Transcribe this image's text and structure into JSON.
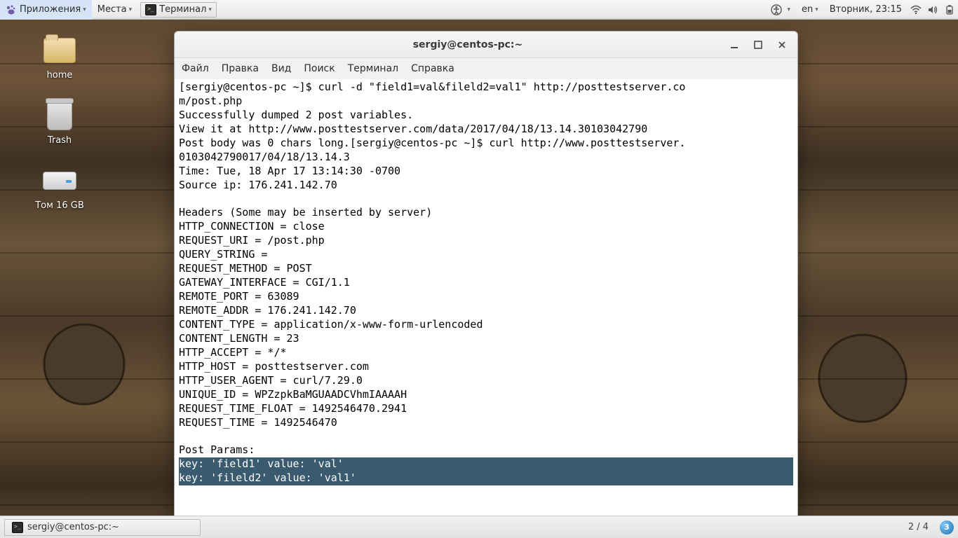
{
  "panel": {
    "applications": "Приложения",
    "places": "Места",
    "terminal": "Терминал",
    "lang": "en",
    "datetime": "Вторник, 23:15"
  },
  "desktop_icons": {
    "home": "home",
    "trash": "Trash",
    "volume": "Том 16 GB"
  },
  "window": {
    "title": "sergiy@centos-pc:~",
    "menu": {
      "file": "Файл",
      "edit": "Правка",
      "view": "Вид",
      "search": "Поиск",
      "terminal": "Терминал",
      "help": "Справка"
    },
    "lines": [
      "[sergiy@centos-pc ~]$ curl -d \"field1=val&fileld2=val1\" http://posttestserver.co",
      "m/post.php",
      "Successfully dumped 2 post variables.",
      "View it at http://www.posttestserver.com/data/2017/04/18/13.14.30103042790",
      "Post body was 0 chars long.[sergiy@centos-pc ~]$ curl http://www.posttestserver.",
      "0103042790017/04/18/13.14.3",
      "Time: Tue, 18 Apr 17 13:14:30 -0700",
      "Source ip: 176.241.142.70",
      "",
      "Headers (Some may be inserted by server)",
      "HTTP_CONNECTION = close",
      "REQUEST_URI = /post.php",
      "QUERY_STRING = ",
      "REQUEST_METHOD = POST",
      "GATEWAY_INTERFACE = CGI/1.1",
      "REMOTE_PORT = 63089",
      "REMOTE_ADDR = 176.241.142.70",
      "CONTENT_TYPE = application/x-www-form-urlencoded",
      "CONTENT_LENGTH = 23",
      "HTTP_ACCEPT = */*",
      "HTTP_HOST = posttestserver.com",
      "HTTP_USER_AGENT = curl/7.29.0",
      "UNIQUE_ID = WPZzpkBaMGUAADCVhmIAAAAH",
      "REQUEST_TIME_FLOAT = 1492546470.2941",
      "REQUEST_TIME = 1492546470",
      "",
      "Post Params:"
    ],
    "selected_lines": [
      "key: 'field1' value: 'val'",
      "key: 'fileld2' value: 'val1'"
    ]
  },
  "taskbar": {
    "app": "sergiy@centos-pc:~",
    "workspace": "2 / 4",
    "ws_badge": "3"
  }
}
